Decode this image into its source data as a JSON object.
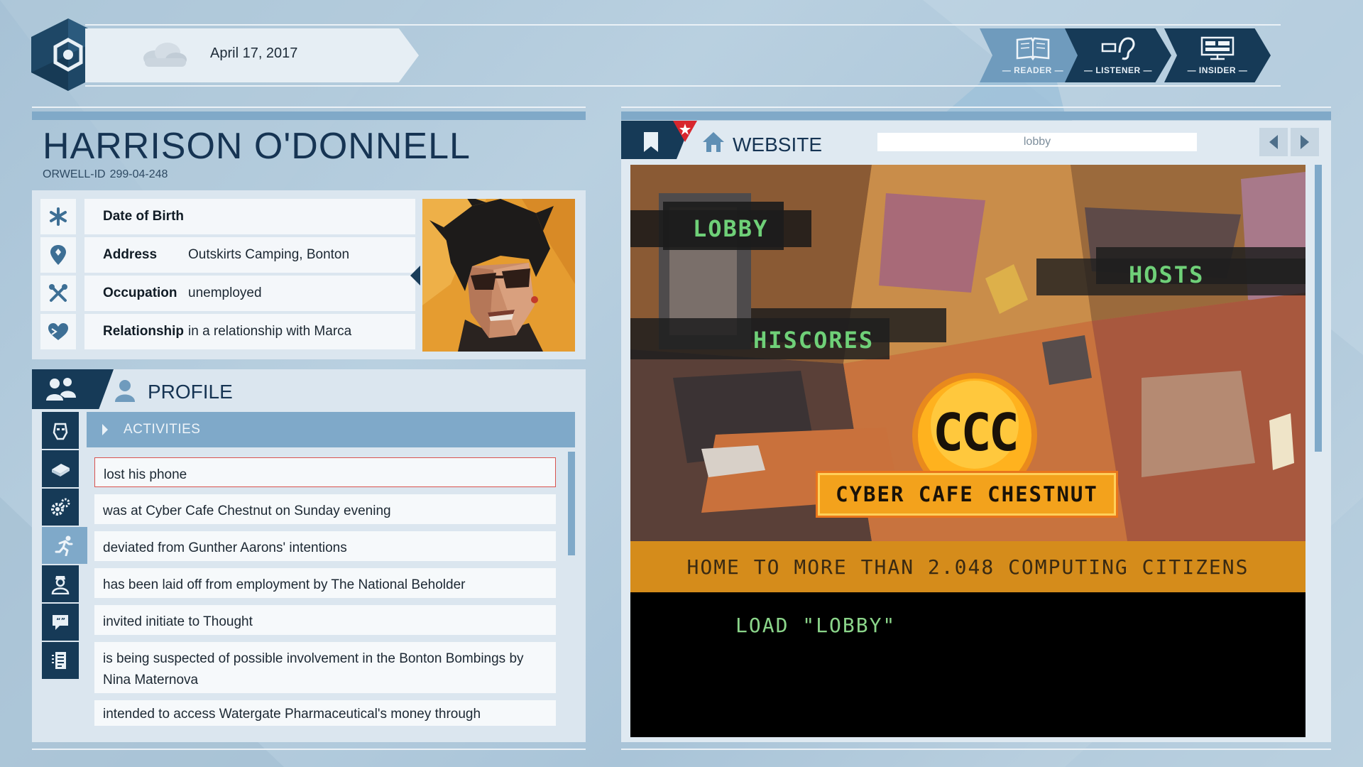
{
  "header": {
    "date": "April 17, 2017",
    "modes": [
      {
        "label": "— READER —",
        "icon": "book-icon",
        "active": true
      },
      {
        "label": "— LISTENER —",
        "icon": "ear-icon",
        "active": false
      },
      {
        "label": "— INSIDER —",
        "icon": "monitor-icon",
        "active": false
      }
    ]
  },
  "person": {
    "name": "HARRISON O'DONNELL",
    "orwell_id_label": "ORWELL-ID",
    "orwell_id": "299-04-248",
    "fields": [
      {
        "label": "Date of Birth",
        "value": "",
        "icon": "asterisk-icon"
      },
      {
        "label": "Address",
        "value": "Outskirts Camping, Bonton",
        "icon": "location-pin-icon"
      },
      {
        "label": "Occupation",
        "value": "unemployed",
        "icon": "tools-icon"
      },
      {
        "label": "Relationship",
        "value": "in a relationship with Marca",
        "icon": "heart-icon"
      }
    ]
  },
  "profile": {
    "title": "PROFILE",
    "section": "ACTIVITIES",
    "activities": [
      "lost his phone",
      "was at Cyber Cafe Chestnut on Sunday evening",
      "deviated from Gunther Aarons' intentions",
      "has been laid off from employment by The National Beholder",
      "invited initiate to Thought",
      "is being suspected of possible involvement in the Bonton Bombings by Nina Maternova",
      "intended to access Watergate Pharmaceutical's money through"
    ],
    "selected_index": 0
  },
  "website": {
    "label": "WEBSITE",
    "url": "lobby",
    "menu": {
      "lobby": "LOBBY",
      "hiscores": "HISCORES",
      "hosts": "HOSTS"
    },
    "logo_text": "CCC",
    "brand": "CYBER CAFE CHESTNUT",
    "tagline": "HOME TO MORE THAN 2.048 COMPUTING CITIZENS",
    "console": "LOAD \"LOBBY\""
  },
  "colors": {
    "navy": "#163a57",
    "accent_blue": "#7fa9c9",
    "terminal_green": "#6fd078",
    "cafe_orange": "#f3a21c",
    "selected_border": "#d9534f"
  }
}
